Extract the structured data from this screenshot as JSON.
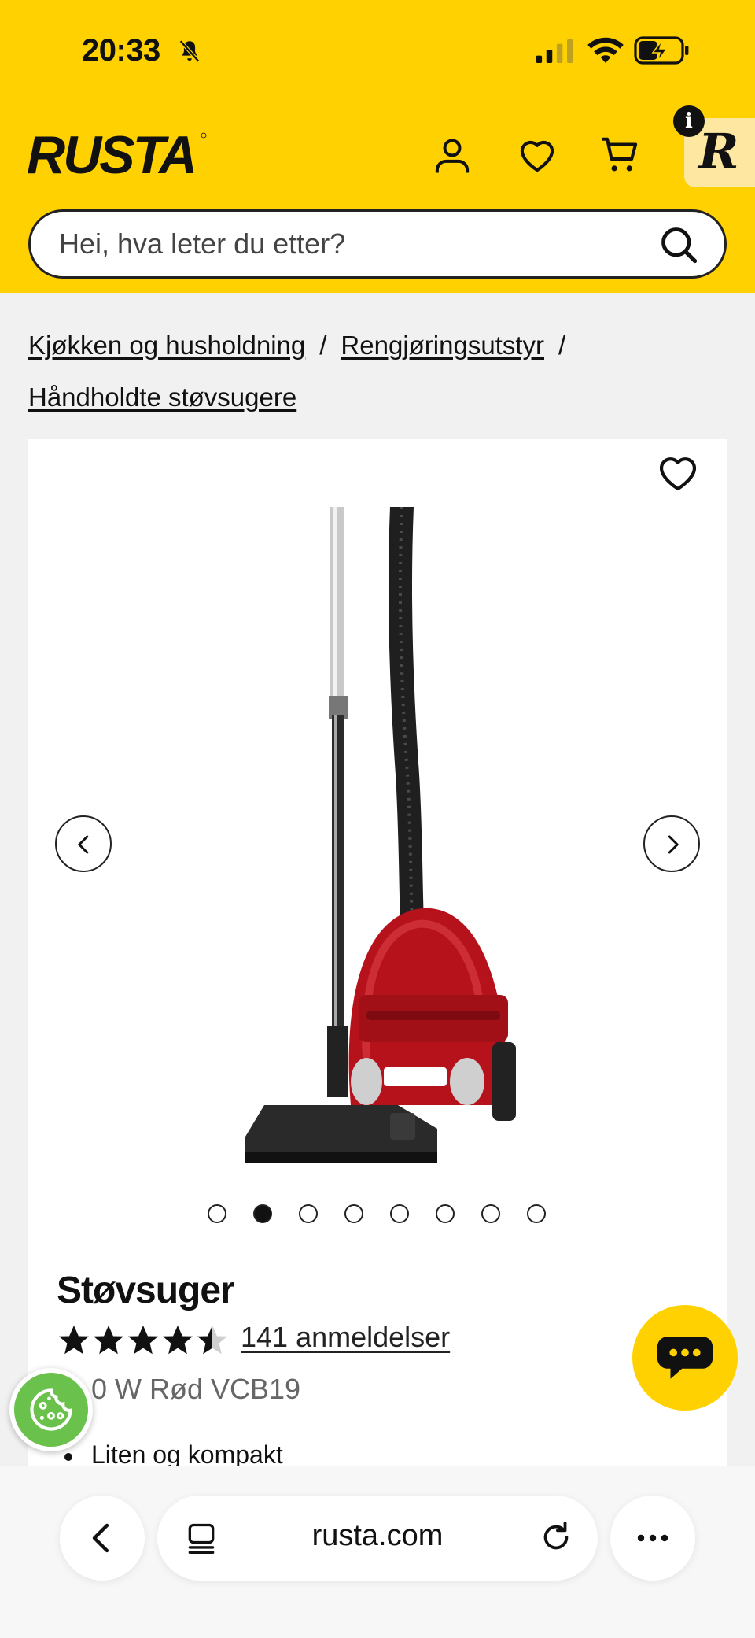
{
  "status_bar": {
    "time": "20:33",
    "icons": [
      "bell-slash-icon",
      "signal-icon",
      "wifi-icon",
      "battery-charging-icon"
    ]
  },
  "header": {
    "logo_text": "RUSTA",
    "icons": [
      "account-icon",
      "heart-icon",
      "cart-icon"
    ],
    "info_badge": "i",
    "r_badge": "R",
    "brand_color": "#ffd100"
  },
  "search": {
    "placeholder": "Hei, hva leter du etter?"
  },
  "breadcrumb": {
    "items": [
      "Kjøkken og husholdning",
      "Rengjøringsutstyr",
      "Håndholdte støvsugere"
    ],
    "separator": "/"
  },
  "product": {
    "image_alt": "Red canister vacuum cleaner",
    "carousel": {
      "total": 8,
      "active_index": 1
    },
    "title": "Støvsuger",
    "rating": 4.5,
    "rating_max": 5,
    "reviews_label": "141 anmeldelser",
    "subtitle": "0 W Rød VCB19",
    "bullets": [
      "Liten og kompakt"
    ]
  },
  "floating": {
    "cookie_icon": "cookie-icon",
    "chat_icon": "chat-icon"
  },
  "browser_bar": {
    "url": "rusta.com",
    "icons": [
      "back-icon",
      "tabs-icon",
      "reload-icon",
      "more-icon"
    ]
  }
}
